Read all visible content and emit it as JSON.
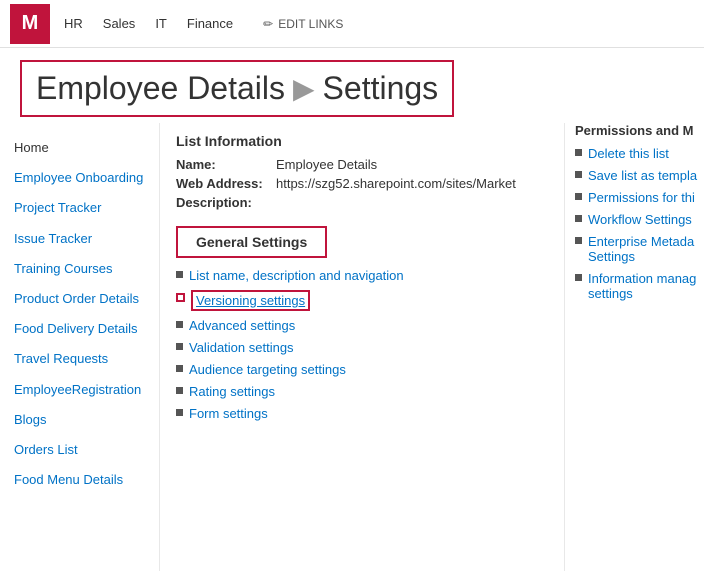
{
  "logo": {
    "letter": "M",
    "bg": "#c0143c"
  },
  "nav": {
    "links": [
      "HR",
      "Sales",
      "IT",
      "Finance"
    ],
    "edit_label": "EDIT LINKS"
  },
  "breadcrumb": {
    "site": "Employee Details",
    "separator": "▶",
    "page": "Settings"
  },
  "sidebar": {
    "items": [
      {
        "label": "Home",
        "type": "plain"
      },
      {
        "label": "Employee Onboarding",
        "type": "link"
      },
      {
        "label": "Project Tracker",
        "type": "link"
      },
      {
        "label": "Issue Tracker",
        "type": "link"
      },
      {
        "label": "Training Courses",
        "type": "link"
      },
      {
        "label": "Product Order Details",
        "type": "link"
      },
      {
        "label": "Food Delivery Details",
        "type": "link"
      },
      {
        "label": "Travel Requests",
        "type": "link"
      },
      {
        "label": "EmployeeRegistration",
        "type": "link"
      },
      {
        "label": "Blogs",
        "type": "link"
      },
      {
        "label": "Orders List",
        "type": "link"
      },
      {
        "label": "Food Menu Details",
        "type": "link"
      }
    ]
  },
  "list_info": {
    "section_title": "List Information",
    "name_label": "Name:",
    "name_value": "Employee Details",
    "web_address_label": "Web Address:",
    "web_address_value": "https://szg52.sharepoint.com/sites/Market",
    "description_label": "Description:"
  },
  "general_settings": {
    "box_label": "General Settings",
    "left_links": [
      {
        "label": "List name, description and navigation",
        "active": false,
        "underlined": false
      },
      {
        "label": "Versioning settings",
        "active": true,
        "underlined": true
      },
      {
        "label": "Advanced settings",
        "active": false,
        "underlined": false
      },
      {
        "label": "Validation settings",
        "active": false,
        "underlined": false
      },
      {
        "label": "Audience targeting settings",
        "active": false,
        "underlined": false
      },
      {
        "label": "Rating settings",
        "active": false,
        "underlined": false
      },
      {
        "label": "Form settings",
        "active": false,
        "underlined": false
      }
    ]
  },
  "permissions_panel": {
    "title": "Permissions and M",
    "links": [
      {
        "label": "Delete this list"
      },
      {
        "label": "Save list as templa"
      },
      {
        "label": "Permissions for thi"
      },
      {
        "label": "Workflow Settings"
      },
      {
        "label": "Enterprise Metada Settings"
      },
      {
        "label": "Information manag settings"
      }
    ]
  }
}
